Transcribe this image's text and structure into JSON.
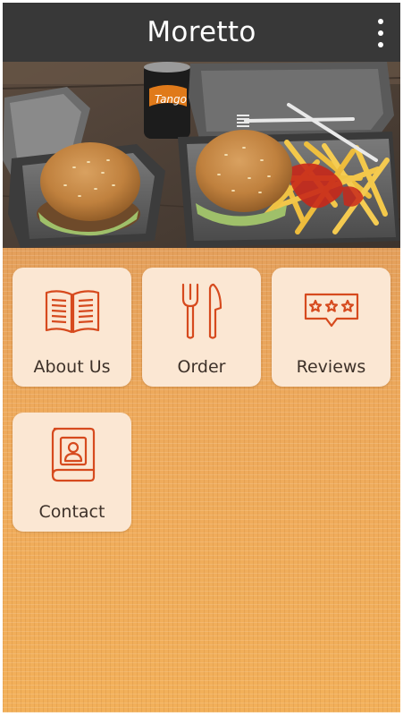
{
  "app": {
    "title": "Moretto",
    "menu_icon": "more-vert-icon"
  },
  "hero": {
    "slide_count": 2,
    "active_slide": 2,
    "can_text": "Tango"
  },
  "tiles": [
    {
      "label": "About Us",
      "icon": "open-book-icon"
    },
    {
      "label": "Order",
      "icon": "fork-knife-icon"
    },
    {
      "label": "Reviews",
      "icon": "star-rating-icon"
    },
    {
      "label": "Contact",
      "icon": "contact-book-icon"
    }
  ],
  "colors": {
    "appbar": "#383838",
    "accent_icon": "#d64a1e",
    "tile_bg": "#fbe7d3",
    "background": "#eeaa5e"
  }
}
